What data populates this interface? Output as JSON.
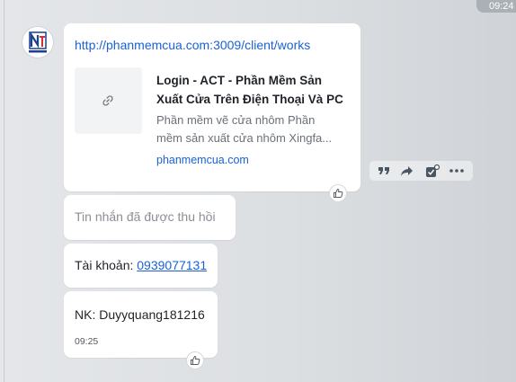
{
  "header": {
    "time_label": "09:24"
  },
  "conversation": {
    "sender": {
      "avatar_icon": "company-logo-icon"
    },
    "messages": [
      {
        "type": "link",
        "url": "http://phanmemcua.com:3009/client/works",
        "preview": {
          "thumbnail_icon": "link-icon",
          "title": "Login - ACT - Phần Mềm Sản Xuất Cửa Trên Điện Thoại Và PC",
          "description_line1": "Phần mềm vẽ cửa nhôm Phần",
          "description_line2": "mềm sản xuất cửa nhôm Xingfa...",
          "domain": "phanmemcua.com"
        },
        "reaction_icon": "thumbs-up-icon"
      },
      {
        "type": "recalled",
        "text": "Tin nhắn đã được thu hồi"
      },
      {
        "type": "text",
        "label": "Tài khoản: ",
        "phone": "0939077131"
      },
      {
        "type": "text",
        "text": "NK: Duyyquang181216",
        "time": "09:25",
        "reaction_icon": "thumbs-up-icon"
      }
    ],
    "hover_actions": [
      {
        "name": "quote-icon"
      },
      {
        "name": "share-icon"
      },
      {
        "name": "mark-icon"
      },
      {
        "name": "more-icon"
      }
    ]
  },
  "colors": {
    "link": "#1a61d6",
    "bubble": "#ffffff",
    "background": "#dcdfe2",
    "action_icon": "#4a5563"
  }
}
